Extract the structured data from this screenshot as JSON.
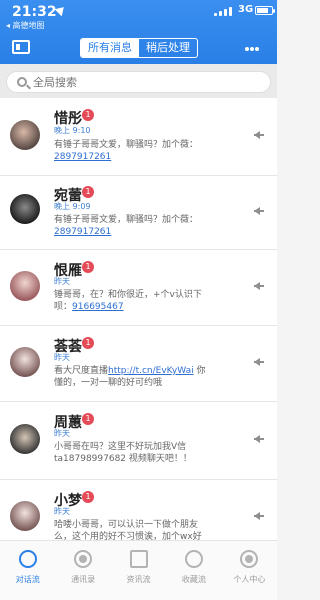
{
  "status": {
    "time": "21:32",
    "back_app": "◂ 高德地图",
    "network": "3G"
  },
  "header": {
    "tabs": [
      "所有消息",
      "稍后处理"
    ]
  },
  "search": {
    "placeholder": "全局搜索"
  },
  "messages": [
    {
      "name": "惜彤",
      "badge": "1",
      "time": "晚上 9:10",
      "line1": "有锤子哥哥文爱，聊骚吗？加个薇：",
      "link": "2897917261"
    },
    {
      "name": "宛蕾",
      "badge": "1",
      "time": "晚上 9:09",
      "line1": "有锤子哥哥文爱，聊骚吗？加个薇：",
      "link": "2897917261"
    },
    {
      "name": "恨雁",
      "badge": "1",
      "time": "昨天",
      "line1": "锤哥哥，在？和你很近，+个v认识下",
      "line2_prefix": "呗：",
      "link": "916695467"
    },
    {
      "name": "荟荟",
      "badge": "1",
      "time": "昨天",
      "line1_prefix": "看大尺度直播",
      "link": "http://t.cn/EvKyWai",
      "line1_suffix": " 你",
      "line2": "懂的，一对一聊的好可约哦"
    },
    {
      "name": "周蕙",
      "badge": "1",
      "time": "昨天",
      "line1": "小哥哥在吗？这里不好玩加我V信",
      "line2": "ta18798997682 视频聊天吧！！"
    },
    {
      "name": "小梦",
      "badge": "1",
      "time": "昨天",
      "line1": "哈喽小哥哥，可以认识一下做个朋友",
      "line2": "么，这个用的好不习惯诶，加个wx好"
    }
  ],
  "bottom_nav": [
    {
      "label": "对话流",
      "icon": "chat-icon",
      "active": true
    },
    {
      "label": "通讯录",
      "icon": "contacts-icon",
      "active": false
    },
    {
      "label": "资讯流",
      "icon": "news-icon",
      "active": false
    },
    {
      "label": "收藏流",
      "icon": "favorites-icon",
      "active": false
    },
    {
      "label": "个人中心",
      "icon": "profile-icon",
      "active": false
    }
  ],
  "colors": {
    "brand": "#2a7fe6",
    "badge": "#e44b57"
  }
}
